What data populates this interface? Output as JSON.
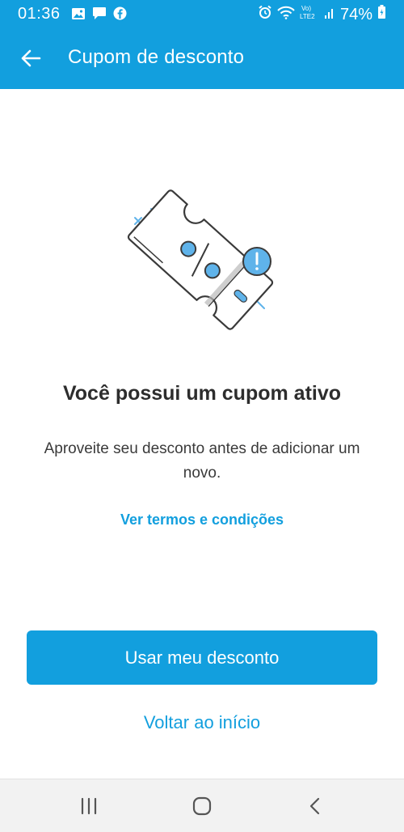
{
  "status_bar": {
    "time": "01:36",
    "battery": "74%",
    "icons_left": [
      "image-icon",
      "message-icon",
      "facebook-icon"
    ],
    "icons_right": [
      "alarm-icon",
      "wifi-icon",
      "volte-lte2-icon",
      "signal-icon",
      "battery-icon"
    ]
  },
  "toolbar": {
    "title": "Cupom de desconto",
    "back_icon": "arrow-left-icon"
  },
  "main": {
    "illustration": "coupon-ticket-illustration",
    "heading": "Você possui um cupom ativo",
    "description": "Aproveite seu desconto antes de adicionar um novo.",
    "terms_link": "Ver termos e condições",
    "primary_button": "Usar meu desconto",
    "secondary_link": "Voltar ao início"
  },
  "nav_bar": {
    "icons": [
      "recents-icon",
      "home-icon",
      "back-icon"
    ]
  },
  "colors": {
    "accent": "#129fde",
    "text": "#2d2d2d",
    "illustration_blue": "#5fb3ea",
    "nav_bg": "#f2f2f2"
  }
}
